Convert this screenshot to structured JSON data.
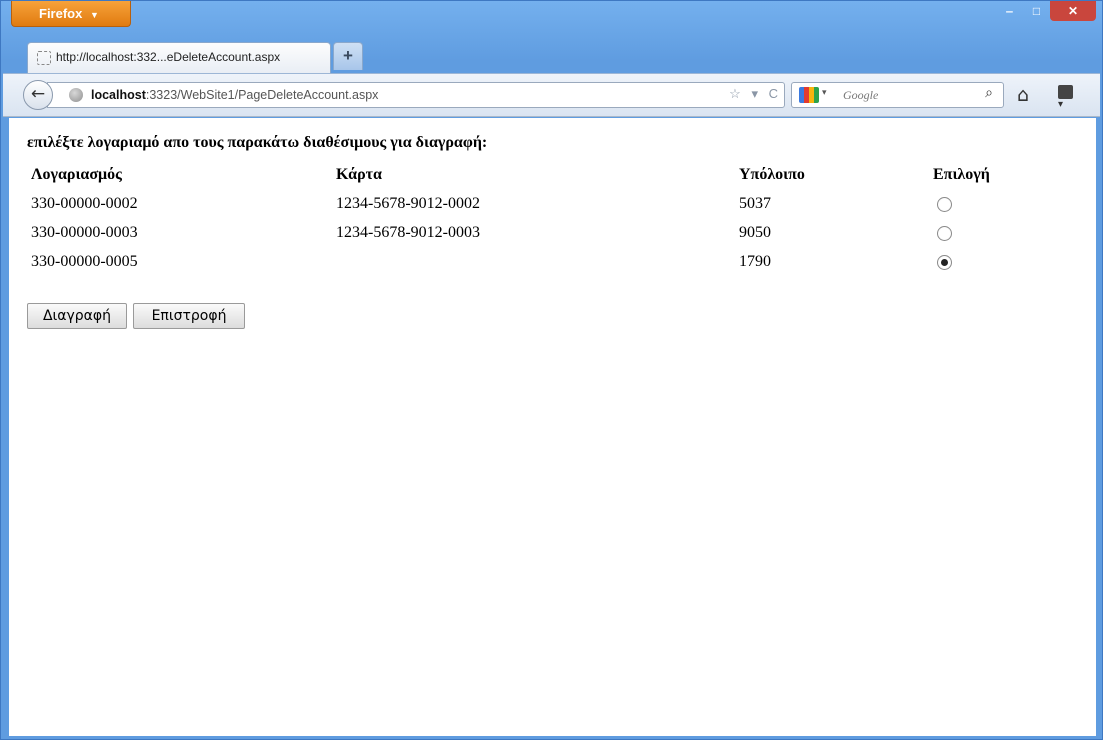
{
  "browser": {
    "menu_label": "Firefox",
    "menu_arrow": "▼",
    "window_controls": {
      "minimize": "‒",
      "maximize": "□",
      "close": "✕"
    },
    "tab": {
      "title": "http://localhost:332...eDeleteAccount.aspx"
    },
    "new_tab_label": "+",
    "nav": {
      "back": "←",
      "url_host": "localhost",
      "url_rest": ":3323/WebSite1/PageDeleteAccount.aspx",
      "url_tools": {
        "star": "☆",
        "dropdown": "▾",
        "reload": "C"
      },
      "search_engine_dropdown": "▾",
      "search_placeholder": "Google",
      "search_icon": "⌕",
      "home": "⌂",
      "bookmarks_dropdown": "▾"
    }
  },
  "page": {
    "heading": "επιλέξτε λογαριαμό απο τους παρακάτω διαθέσιμους για διαγραφή:",
    "columns": [
      "Λογαριασμός",
      "Κάρτα",
      "Υπόλοιπο",
      "Επιλογή"
    ],
    "rows": [
      {
        "account": "330-00000-0002",
        "card": "1234-5678-9012-0002",
        "balance": "5037",
        "selected": false
      },
      {
        "account": "330-00000-0003",
        "card": "1234-5678-9012-0003",
        "balance": "9050",
        "selected": false
      },
      {
        "account": "330-00000-0005",
        "card": "",
        "balance": "1790",
        "selected": true
      }
    ],
    "buttons": {
      "delete": "Διαγραφή",
      "return": "Επιστροφή"
    }
  }
}
